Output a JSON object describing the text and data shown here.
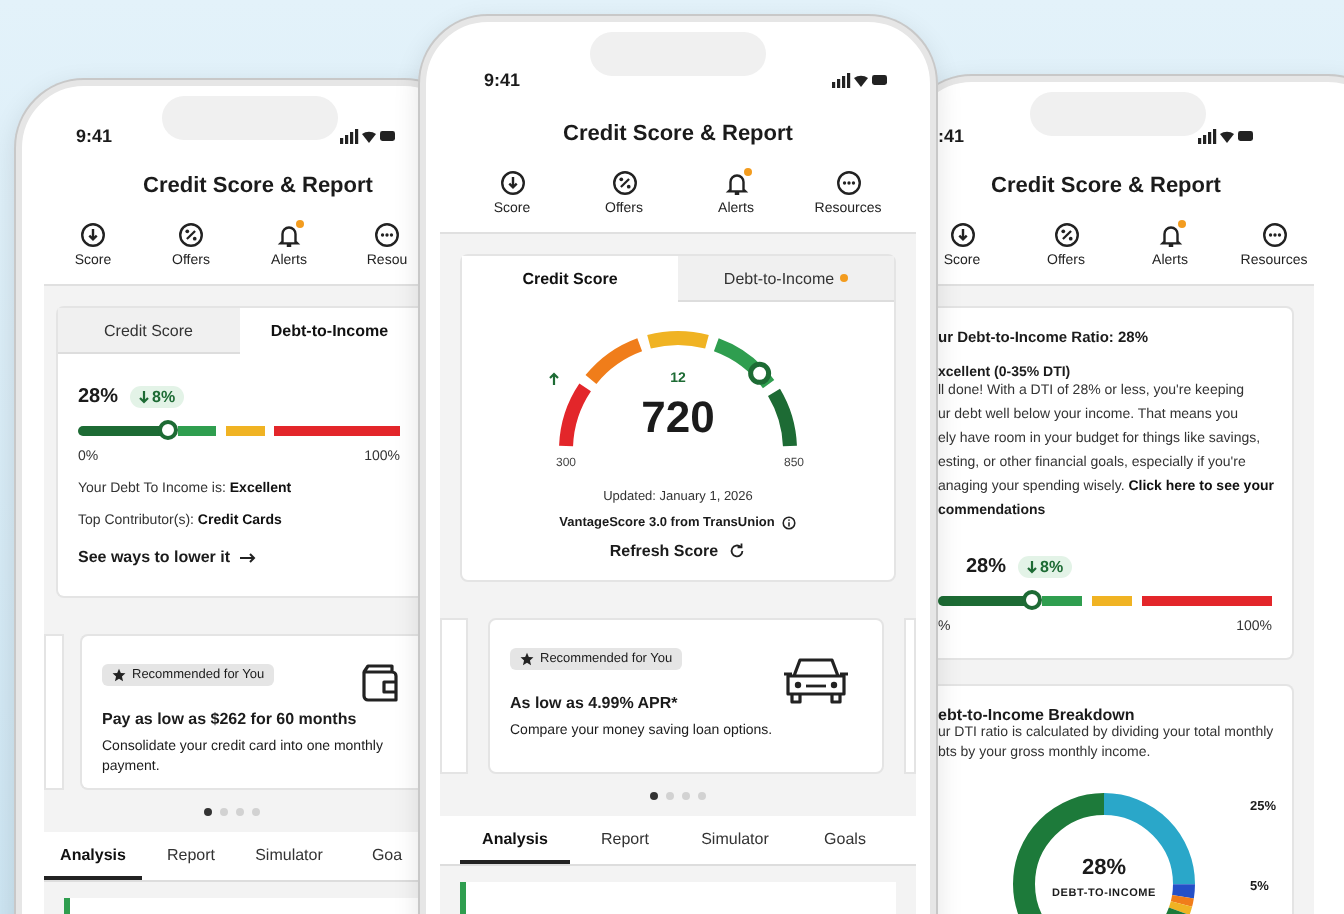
{
  "phones": [
    {
      "status_time": "9:41",
      "title": "Credit Score & Report",
      "nav": [
        {
          "label": "Score",
          "alert": false
        },
        {
          "label": "Offers",
          "alert": false
        },
        {
          "label": "Alerts",
          "alert": true
        },
        {
          "label": "Resou",
          "alert": false
        }
      ],
      "sections": [
        {
          "kind": "dti-card",
          "tabs": [
            {
              "label": "Credit Score",
              "selected": false,
              "alert": false
            },
            {
              "label": "Debt-to-Income",
              "selected": true,
              "alert": false
            }
          ],
          "value": "28%",
          "change": "8%",
          "level": 0.28,
          "min": "0%",
          "max": "100%",
          "lines": [
            "Your Debt To Income is: **Excellent**",
            "Top Contributor(s): **Credit Cards**"
          ],
          "link": "See ways to lower it"
        },
        {
          "kind": "card-offer",
          "badge": "Recommended for You",
          "headline": "Pay as low as $262 for 60 months",
          "body": "Consolidate your credit card into one monthly payment."
        },
        {
          "kind": "pager",
          "pages": [
            {
              "selected": true
            },
            {
              "selected": false
            },
            {
              "selected": false
            },
            {
              "selected": false
            }
          ]
        },
        {
          "kind": "bottom-tabs",
          "tabs": [
            {
              "label": "Analysis",
              "selected": true
            },
            {
              "label": "Report",
              "selected": false
            },
            {
              "label": "Simulator",
              "selected": false
            },
            {
              "label": "Goa",
              "selected": false
            }
          ]
        },
        {
          "kind": "card-edge"
        }
      ]
    },
    {
      "status_time": "9:41",
      "title": "Credit Score & Report",
      "nav": [
        {
          "label": "Score",
          "alert": false
        },
        {
          "label": "Offers",
          "alert": false
        },
        {
          "label": "Alerts",
          "alert": true
        },
        {
          "label": "Resources",
          "alert": false
        }
      ],
      "sections": [
        {
          "kind": "score-card",
          "tabs": [
            {
              "label": "Credit Score",
              "selected": true,
              "alert": false
            },
            {
              "label": "Debt-to-Income",
              "selected": false,
              "alert": true
            }
          ],
          "change": "12",
          "score": "720",
          "min": "300",
          "max": "850",
          "level": 0.76,
          "updated": "Updated: January 1, 2026",
          "source": "VantageScore 3.0 from TransUnion",
          "action": "Refresh Score"
        },
        {
          "kind": "loan-offer",
          "badge": "Recommended for You",
          "headline": "As low as 4.99% APR*",
          "body": "Compare your money saving loan options."
        },
        {
          "kind": "pager",
          "pages": [
            {
              "selected": true
            },
            {
              "selected": false
            },
            {
              "selected": false
            },
            {
              "selected": false
            }
          ]
        },
        {
          "kind": "bottom-tabs",
          "tabs": [
            {
              "label": "Analysis",
              "selected": true
            },
            {
              "label": "Report",
              "selected": false
            },
            {
              "label": "Simulator",
              "selected": false
            },
            {
              "label": "Goals",
              "selected": false
            }
          ]
        },
        {
          "kind": "card-edge"
        }
      ]
    },
    {
      "status_time": ":41",
      "title": "Credit Score & Report",
      "nav": [
        {
          "label": "Score",
          "alert": false
        },
        {
          "label": "Offers",
          "alert": false
        },
        {
          "label": "Alerts",
          "alert": true
        },
        {
          "label": "Resources",
          "alert": false
        }
      ],
      "sections": [
        {
          "kind": "details-card",
          "heading": "ur Debt-to-Income Ratio: 28%",
          "rating": "xcellent (0-35% DTI)",
          "lines": [
            "ll done! With a DTI of 28% or less, you're keeping",
            "ur debt well below your income. That means you",
            "ely have room in your budget for things like savings,",
            "esting, or other financial goals, especially if you're",
            "anaging your spending wisely. **Click here to see your**"
          ],
          "tail": "commendations",
          "value": "28%",
          "change": "8%",
          "level": 0.28,
          "min": "%",
          "max": "100%"
        },
        {
          "kind": "breakdown-card",
          "title": "ebt-to-Income Breakdown",
          "lines": [
            "ur DTI ratio is calculated by dividing your total monthly",
            "bts by your gross monthly income."
          ],
          "center_value": "28%",
          "center_label": "DEBT-TO-INCOME",
          "labels": [
            "25%",
            "5%"
          ]
        }
      ]
    }
  ]
}
